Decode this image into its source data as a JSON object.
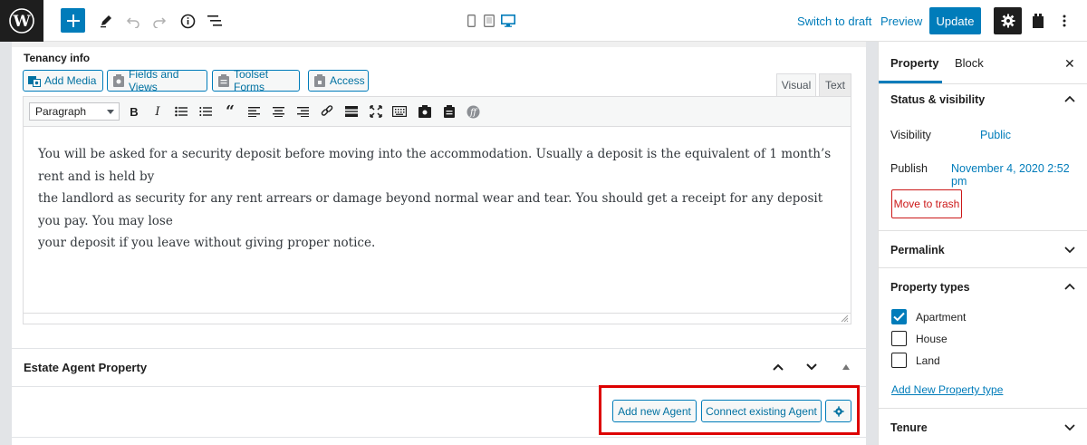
{
  "topbar": {
    "switch_to_draft": "Switch to draft",
    "preview": "Preview",
    "update": "Update"
  },
  "metabox": {
    "title": "Tenancy info",
    "buttons": [
      "Add Media",
      "Fields and Views",
      "Toolset Forms",
      "Access"
    ],
    "tab_visual": "Visual",
    "tab_text": "Text",
    "format_select": "Paragraph",
    "content_lines": [
      "You will be asked for a security deposit before moving into the accommodation. Usually a deposit is the equivalent of 1 month’s rent and is held by",
      "the landlord as security for any rent arrears or damage beyond normal wear and tear. You should get a receipt for any deposit you pay. You may lose",
      "your deposit if you leave without giving proper notice."
    ]
  },
  "estate": {
    "title": "Estate Agent Property",
    "add_agent": "Add new Agent",
    "connect_agent": "Connect existing Agent"
  },
  "sidebar": {
    "tab_property": "Property",
    "tab_block": "Block",
    "close": "✕",
    "status_title": "Status & visibility",
    "visibility_label": "Visibility",
    "visibility_value": "Public",
    "publish_label": "Publish",
    "publish_value": "November 4, 2020 2:52 pm",
    "move_to_trash": "Move to trash",
    "permalink_title": "Permalink",
    "property_types_title": "Property types",
    "property_types": [
      {
        "label": "Apartment",
        "checked": true
      },
      {
        "label": "House",
        "checked": false
      },
      {
        "label": "Land",
        "checked": false
      }
    ],
    "add_new_type": "Add New Property type",
    "tenure_title": "Tenure"
  },
  "colors": {
    "accent": "#007cba",
    "danger": "#cc1818",
    "highlight": "#dd0000"
  }
}
